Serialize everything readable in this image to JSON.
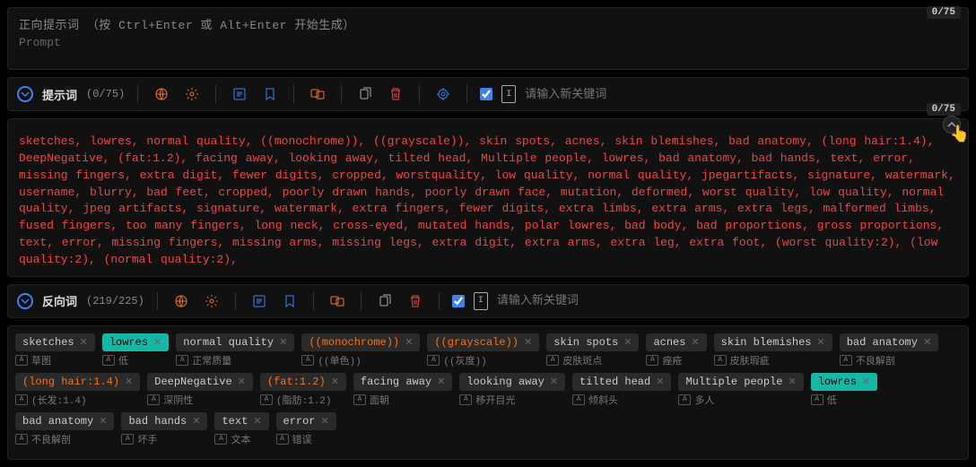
{
  "positive": {
    "label": "正向提示词 （按 Ctrl+Enter 或 Alt+Enter 开始生成）",
    "sub": "Prompt",
    "counter": "0/75"
  },
  "prompt_bar": {
    "title": "提示词",
    "count": "(0/75)",
    "placeholder": "请输入新关键词"
  },
  "negative": {
    "counter": "0/75",
    "text": "sketches, lowres, normal quality, ((monochrome)), ((grayscale)), skin spots, acnes, skin blemishes, bad anatomy, (long hair:1.4), DeepNegative, (fat:1.2), facing away, looking away, tilted head, Multiple people, lowres, bad anatomy, bad hands, text, error, missing fingers, extra digit, fewer digits, cropped, worstquality, low quality, normal quality, jpegartifacts, signature, watermark, username, blurry, bad feet, cropped, poorly drawn hands, poorly drawn face, mutation, deformed, worst quality, low quality, normal quality, jpeg artifacts, signature, watermark, extra fingers, fewer digits, extra limbs, extra arms, extra legs, malformed limbs, fused fingers, too many fingers, long neck, cross-eyed, mutated hands, polar lowres, bad body, bad proportions, gross proportions, text, error, missing fingers, missing arms, missing legs, extra digit, extra arms, extra leg, extra foot, (worst quality:2), (low quality:2), (normal quality:2),"
  },
  "neg_bar": {
    "title": "反向词",
    "count": "(219/225)",
    "placeholder": "请输入新关键词"
  },
  "tags": [
    {
      "en": "sketches",
      "cn": "草图",
      "c": ""
    },
    {
      "en": "lowres",
      "cn": "低",
      "c": "teal"
    },
    {
      "en": "normal quality",
      "cn": "正常质量",
      "c": ""
    },
    {
      "en": "((monochrome))",
      "cn": "((单色))",
      "c": "orange"
    },
    {
      "en": "((grayscale))",
      "cn": "((灰度))",
      "c": "orange"
    },
    {
      "en": "skin spots",
      "cn": "皮肤斑点",
      "c": ""
    },
    {
      "en": "acnes",
      "cn": "痤疮",
      "c": ""
    },
    {
      "en": "skin blemishes",
      "cn": "皮肤瑕疵",
      "c": ""
    },
    {
      "en": "bad anatomy",
      "cn": "不良解剖",
      "c": ""
    },
    {
      "en": "(long hair:1.4)",
      "cn": "(长发:1.4)",
      "c": "orange"
    },
    {
      "en": "DeepNegative",
      "cn": "深阴性",
      "c": ""
    },
    {
      "en": "(fat:1.2)",
      "cn": "(脂肪:1.2)",
      "c": "orange"
    },
    {
      "en": "facing away",
      "cn": "面朝",
      "c": ""
    },
    {
      "en": "looking away",
      "cn": "移开目光",
      "c": ""
    },
    {
      "en": "tilted head",
      "cn": "倾斜头",
      "c": ""
    },
    {
      "en": "Multiple people",
      "cn": "多人",
      "c": ""
    },
    {
      "en": "lowres",
      "cn": "低",
      "c": "teal"
    },
    {
      "en": "bad anatomy",
      "cn": "不良解剖",
      "c": ""
    },
    {
      "en": "bad hands",
      "cn": "坏手",
      "c": ""
    },
    {
      "en": "text",
      "cn": "文本",
      "c": ""
    },
    {
      "en": "error",
      "cn": "错误",
      "c": ""
    }
  ]
}
